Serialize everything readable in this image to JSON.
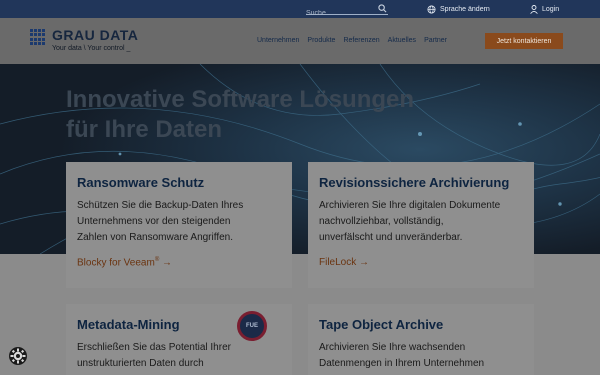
{
  "topbar": {
    "search_placeholder": "Suche",
    "language_label": "Sprache ändern",
    "login_label": "Login"
  },
  "header": {
    "logo_title": "GRAU DATA",
    "logo_tagline": "Your data \\ Your control _",
    "nav": [
      "Unternehmen",
      "Produkte",
      "Referenzen",
      "Aktuelles",
      "Partner"
    ],
    "cta_label": "Jetzt kontaktieren"
  },
  "hero": {
    "title_line1": "Innovative Software Lösungen",
    "title_line2": "für Ihre Daten"
  },
  "cards": [
    {
      "title": "Ransomware Schutz",
      "lines": [
        "Schützen Sie die Backup-Daten Ihres",
        "Unternehmens vor den steigenden",
        "Zahlen von Ransomware Angriffen."
      ],
      "link": "Blocky for Veeam",
      "link_sup": "®",
      "arrow": "→"
    },
    {
      "title": "Revisionssichere Archivierung",
      "lines": [
        "Archivieren Sie Ihre digitalen Dokumente",
        "nachvollziehbar, vollständig,",
        "unverfälscht und unveränderbar."
      ],
      "link": "FileLock",
      "arrow": "→"
    },
    {
      "title": "Metadata-Mining",
      "lines": [
        "Erschließen Sie das Potential Ihrer",
        "unstrukturierten Daten durch"
      ],
      "badge": "FUE"
    },
    {
      "title": "Tape Object Archive",
      "lines": [
        "Archivieren Sie Ihre wachsenden",
        "Datenmengen in Ihrem Unternehmen"
      ]
    }
  ],
  "colors": {
    "topbar": "#21365a",
    "accent": "#8a4a1c",
    "title": "#0e2440"
  }
}
